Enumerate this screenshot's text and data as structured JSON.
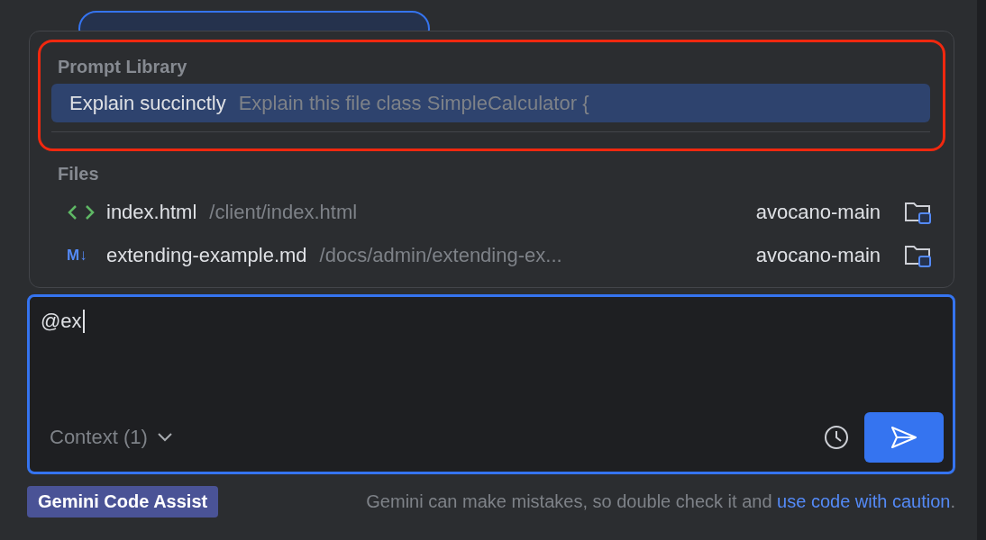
{
  "popup": {
    "prompt_library": {
      "title": "Prompt Library",
      "items": [
        {
          "name": "Explain succinctly",
          "preview": "Explain this file class SimpleCalculator {",
          "selected": true
        }
      ]
    },
    "files": {
      "title": "Files",
      "items": [
        {
          "kind": "html",
          "name": "index.html",
          "path": "/client/index.html",
          "project": "avocano-main"
        },
        {
          "kind": "markdown",
          "icon_text": "M↓",
          "name": "extending-example.md",
          "path": "/docs/admin/extending-ex...",
          "project": "avocano-main"
        }
      ]
    }
  },
  "input": {
    "value": "@ex",
    "context": "Context (1)"
  },
  "footer": {
    "badge": "Gemini Code Assist",
    "disclaimer": "Gemini can make mistakes, so double check it and",
    "link": "use code with caution",
    "end": "."
  }
}
